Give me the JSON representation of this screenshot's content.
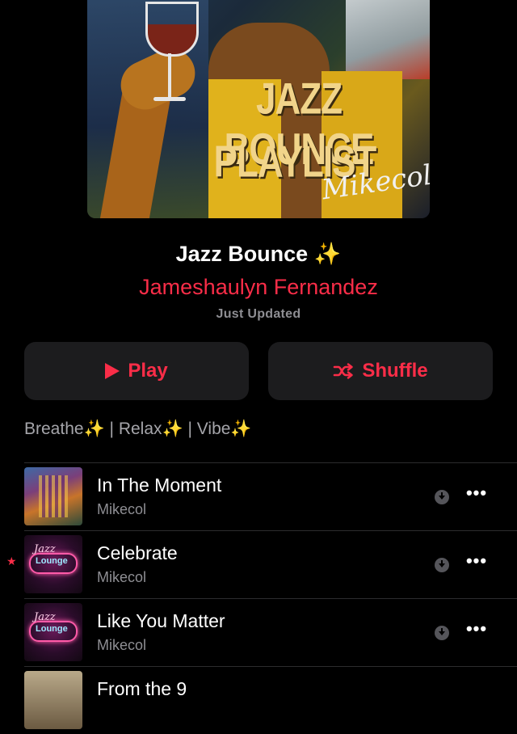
{
  "cover": {
    "title_line1": "JAZZ BOUNCE",
    "title_line2": "PLAYLIST",
    "signature": "Mikecol"
  },
  "playlist": {
    "title": "Jazz Bounce ✨",
    "author": "Jameshaulyn Fernandez",
    "updated": "Just Updated"
  },
  "actions": {
    "play_label": "Play",
    "shuffle_label": "Shuffle"
  },
  "description": "Breathe✨ | Relax✨ | Vibe✨",
  "tracks": [
    {
      "title": "In The Moment",
      "artist": "Mikecol",
      "favorite": false
    },
    {
      "title": "Celebrate",
      "artist": "Mikecol",
      "favorite": true
    },
    {
      "title": "Like You Matter",
      "artist": "Mikecol",
      "favorite": false
    },
    {
      "title": "From the 9",
      "artist": "",
      "favorite": false
    }
  ],
  "art_text": {
    "jazz": "Jazz",
    "lounge": "Lounge"
  },
  "icons": {
    "play": "play-icon",
    "shuffle": "shuffle-icon",
    "download": "download-icon",
    "more": "more-icon",
    "favorite": "star-icon"
  },
  "colors": {
    "accent": "#fa2d48",
    "background": "#000000",
    "button_bg": "#1c1c1e",
    "secondary_text": "#8e8e93"
  }
}
